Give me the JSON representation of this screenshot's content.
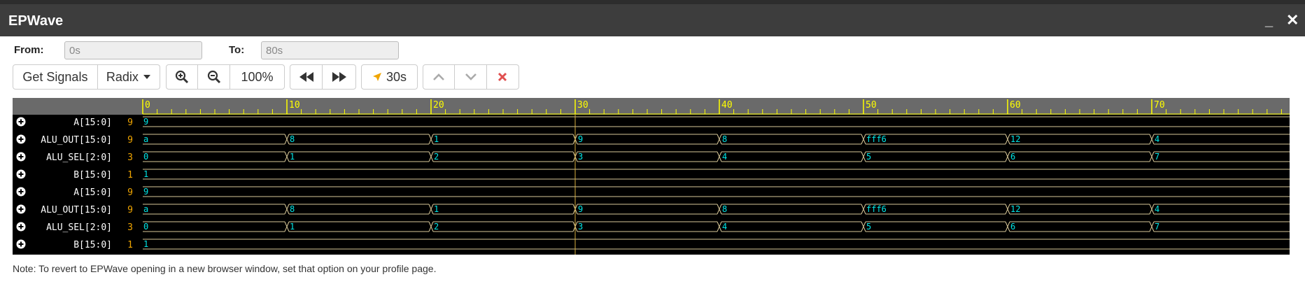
{
  "window": {
    "title": "EPWave",
    "minimize_label": "_",
    "close_label": "✕"
  },
  "range": {
    "from_label": "From:",
    "from_value": "0s",
    "to_label": "To:",
    "to_value": "80s"
  },
  "toolbar": {
    "get_signals_label": "Get Signals",
    "radix_label": "Radix",
    "zoom_level": "100%",
    "cursor_time": "30s",
    "colors": {
      "cursor_arrow": "#f0a500",
      "remove": "#e05050"
    }
  },
  "waveform": {
    "colors": {
      "ruler_tick": "#ffff00",
      "ruler_bg": "#6a6a6a",
      "trace": "#d8c898",
      "value_text": "#00e5e5",
      "name_text": "#ffffff",
      "current_value": "#f0a500",
      "cursor": "#d8b040"
    },
    "time_range": [
      0,
      80
    ],
    "cursor_time": 30,
    "ruler_labels": [
      "0",
      "10",
      "20",
      "30",
      "40",
      "50",
      "60",
      "70"
    ],
    "signals": [
      {
        "name": "A[15:0]",
        "current": "9",
        "segments": [
          {
            "t": 0,
            "v": "9"
          }
        ]
      },
      {
        "name": "ALU_OUT[15:0]",
        "current": "9",
        "segments": [
          {
            "t": 0,
            "v": "a"
          },
          {
            "t": 10,
            "v": "8"
          },
          {
            "t": 20,
            "v": "1"
          },
          {
            "t": 30,
            "v": "9"
          },
          {
            "t": 40,
            "v": "8"
          },
          {
            "t": 50,
            "v": "fff6"
          },
          {
            "t": 60,
            "v": "12"
          },
          {
            "t": 70,
            "v": "4"
          }
        ]
      },
      {
        "name": "ALU_SEL[2:0]",
        "current": "3",
        "segments": [
          {
            "t": 0,
            "v": "0"
          },
          {
            "t": 10,
            "v": "1"
          },
          {
            "t": 20,
            "v": "2"
          },
          {
            "t": 30,
            "v": "3"
          },
          {
            "t": 40,
            "v": "4"
          },
          {
            "t": 50,
            "v": "5"
          },
          {
            "t": 60,
            "v": "6"
          },
          {
            "t": 70,
            "v": "7"
          }
        ]
      },
      {
        "name": "B[15:0]",
        "current": "1",
        "segments": [
          {
            "t": 0,
            "v": "1"
          }
        ]
      },
      {
        "name": "A[15:0]",
        "current": "9",
        "segments": [
          {
            "t": 0,
            "v": "9"
          }
        ]
      },
      {
        "name": "ALU_OUT[15:0]",
        "current": "9",
        "segments": [
          {
            "t": 0,
            "v": "a"
          },
          {
            "t": 10,
            "v": "8"
          },
          {
            "t": 20,
            "v": "1"
          },
          {
            "t": 30,
            "v": "9"
          },
          {
            "t": 40,
            "v": "8"
          },
          {
            "t": 50,
            "v": "fff6"
          },
          {
            "t": 60,
            "v": "12"
          },
          {
            "t": 70,
            "v": "4"
          }
        ]
      },
      {
        "name": "ALU_SEL[2:0]",
        "current": "3",
        "segments": [
          {
            "t": 0,
            "v": "0"
          },
          {
            "t": 10,
            "v": "1"
          },
          {
            "t": 20,
            "v": "2"
          },
          {
            "t": 30,
            "v": "3"
          },
          {
            "t": 40,
            "v": "4"
          },
          {
            "t": 50,
            "v": "5"
          },
          {
            "t": 60,
            "v": "6"
          },
          {
            "t": 70,
            "v": "7"
          }
        ]
      },
      {
        "name": "B[15:0]",
        "current": "1",
        "segments": [
          {
            "t": 0,
            "v": "1"
          }
        ]
      }
    ]
  },
  "note": "Note: To revert to EPWave opening in a new browser window, set that option on your profile page."
}
